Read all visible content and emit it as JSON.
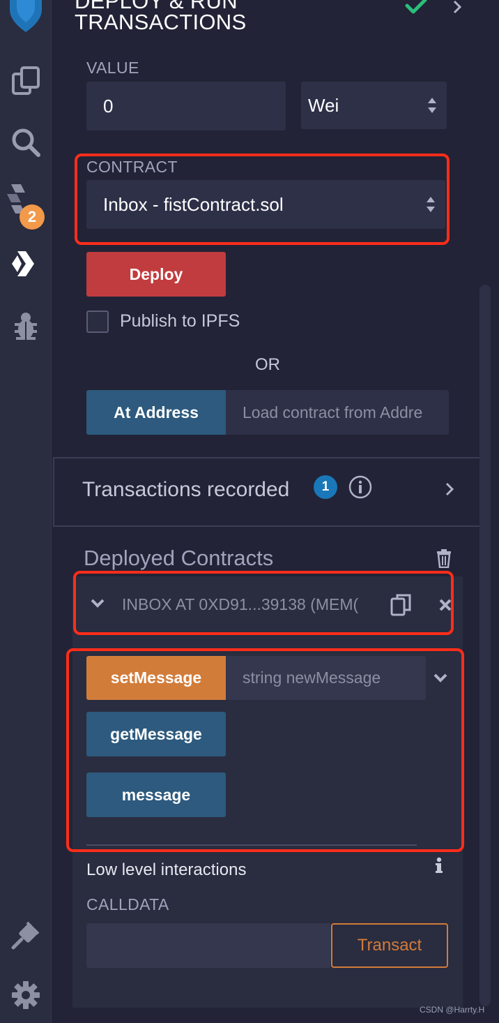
{
  "header": {
    "title_line1": "DEPLOY & RUN",
    "title_line2": "TRANSACTIONS"
  },
  "rail": {
    "items": [
      {
        "icon": "remix-logo-icon"
      },
      {
        "icon": "file-explorer-icon"
      },
      {
        "icon": "search-icon"
      },
      {
        "icon": "solidity-compiler-icon",
        "badge": "2"
      },
      {
        "icon": "deploy-run-icon"
      },
      {
        "icon": "debugger-icon"
      },
      {
        "icon": "plugin-manager-icon"
      },
      {
        "icon": "settings-icon"
      }
    ]
  },
  "value": {
    "label": "VALUE",
    "amount": "0",
    "unit": "Wei"
  },
  "contract": {
    "label": "CONTRACT",
    "selected": "Inbox - fistContract.sol"
  },
  "deploy": {
    "button": "Deploy",
    "publish_label": "Publish to IPFS",
    "or_label": "OR",
    "at_address_button": "At Address",
    "at_address_placeholder": "Load contract from Addre"
  },
  "transactions": {
    "label": "Transactions recorded",
    "count": "1"
  },
  "deployed": {
    "title": "Deployed Contracts",
    "instance_label": "INBOX AT 0XD91...39138 (MEM("
  },
  "functions": {
    "set_message": "setMessage",
    "set_message_placeholder": "string newMessage",
    "get_message": "getMessage",
    "message": "message"
  },
  "low_level": {
    "title": "Low level interactions",
    "calldata_label": "CALLDATA",
    "transact_button": "Transact"
  },
  "watermark": "CSDN @Harrty.H",
  "colors": {
    "deploy": "#c13c3e",
    "blue_button": "#2d5a7e",
    "orange_button": "#d27c3a",
    "annotation_red": "#ff2d1a",
    "badge_orange": "#f2994a",
    "success_green": "#2bbf7a"
  }
}
